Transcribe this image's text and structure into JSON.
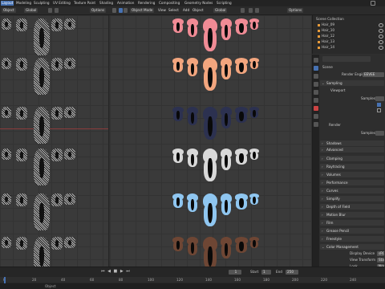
{
  "menubar": {
    "items": [
      {
        "label": "Layout",
        "active": true
      },
      {
        "label": "Modeling"
      },
      {
        "label": "Sculpting"
      },
      {
        "label": "UV Editing"
      },
      {
        "label": "Texture Paint"
      },
      {
        "label": "Shading"
      },
      {
        "label": "Animation"
      },
      {
        "label": "Rendering"
      },
      {
        "label": "Compositing"
      },
      {
        "label": "Geometry Nodes"
      },
      {
        "label": "Scripting"
      }
    ]
  },
  "left_header": {
    "mode": "Object",
    "transform": "Global",
    "options": "Options"
  },
  "main_header": {
    "mode": "Object Mode",
    "view": "View",
    "select": "Select",
    "add": "Add",
    "object": "Object",
    "transform": "Global",
    "options": "Options"
  },
  "outliner": {
    "title": "Scene Collection",
    "items": [
      "Hair_09",
      "Hair_10",
      "Hair_12",
      "Hair_13",
      "Hair_14"
    ]
  },
  "properties": {
    "scene_label": "Scene",
    "render_engine_label": "Render Engine",
    "render_engine_value": "EEVEE",
    "sections": {
      "sampling": "Sampling",
      "viewport": "Viewport",
      "samples": "Samples",
      "render": "Render",
      "render_samples": "Samples",
      "shadows": "Shadows",
      "advanced": "Advanced",
      "clamping": "Clamping",
      "raytracing": "Raytracing",
      "volumes": "Volumes",
      "performance": "Performance",
      "curves": "Curves",
      "simplify": "Simplify",
      "dof": "Depth of Field",
      "motion_blur": "Motion Blur",
      "film": "Film",
      "grease_pencil": "Grease Pencil",
      "freestyle": "Freestyle",
      "color_management": "Color Management",
      "display_device": "Display Device",
      "display_device_value": "sRGB",
      "view_transform": "View Transform",
      "view_transform_value": "Standard",
      "look": "Look",
      "look_value": "None",
      "exposure": "Exposure",
      "gamma": "Gamma"
    }
  },
  "hair_colors": [
    "#f08b95",
    "#f2a57e",
    "#2c3150",
    "#d8d8d8",
    "#8fc6f0",
    "#6e4634"
  ],
  "timeline": {
    "start_label": "Start",
    "start_value": "1",
    "end_label": "End",
    "end_value": "250",
    "current_frame": "1",
    "ticks": [
      "0",
      "20",
      "40",
      "60",
      "80",
      "100",
      "120",
      "140",
      "160",
      "180",
      "200",
      "220",
      "240"
    ]
  },
  "statusbar": {
    "hint": "Object"
  }
}
